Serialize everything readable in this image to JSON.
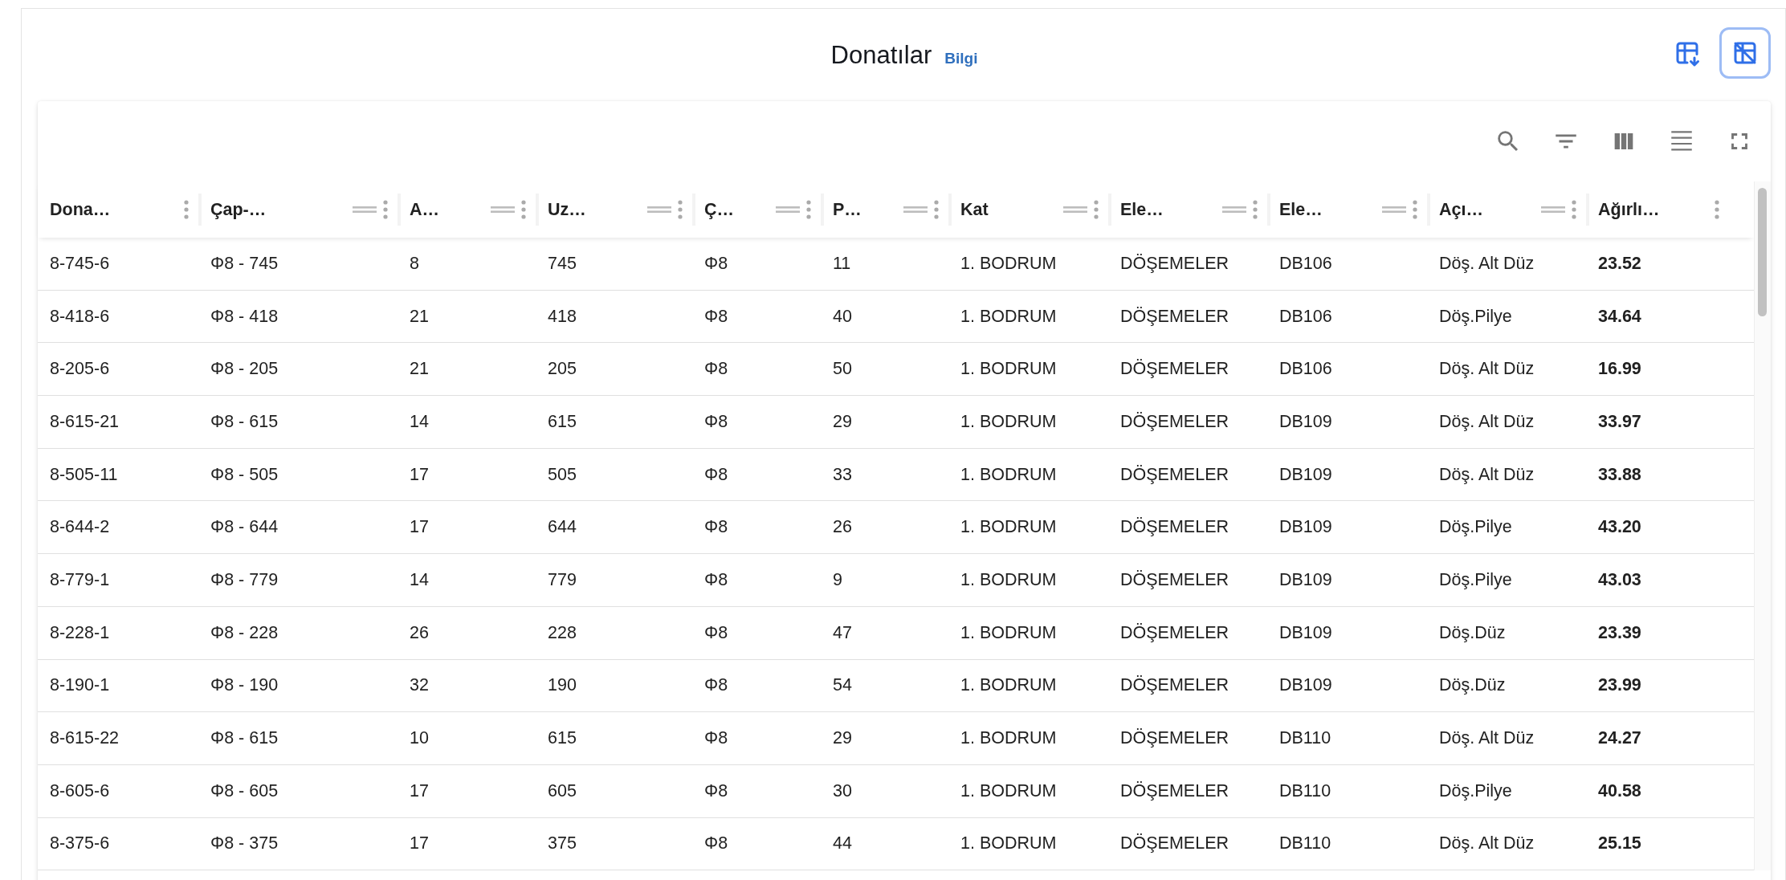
{
  "header": {
    "title": "Donatılar",
    "info_link": "Bilgi",
    "actions": [
      {
        "kind": "export",
        "focused": false
      },
      {
        "kind": "clear",
        "focused": true
      }
    ]
  },
  "toolbar": {
    "tools": [
      {
        "kind": "search"
      },
      {
        "kind": "filter"
      },
      {
        "kind": "columns"
      },
      {
        "kind": "density"
      },
      {
        "kind": "fullscreen"
      }
    ]
  },
  "table": {
    "columns": [
      {
        "label": "Dona…",
        "bold": false
      },
      {
        "label": "Çap-…",
        "drag_handle": true,
        "bold": false
      },
      {
        "label": "A…",
        "drag_handle": true,
        "bold": false
      },
      {
        "label": "Uz…",
        "drag_handle": true,
        "bold": false
      },
      {
        "label": "Ç…",
        "drag_handle": true,
        "bold": false
      },
      {
        "label": "P…",
        "drag_handle": true,
        "bold": false
      },
      {
        "label": "Kat",
        "drag_handle": true,
        "bold": false
      },
      {
        "label": "Ele…",
        "drag_handle": true,
        "bold": false
      },
      {
        "label": "Ele…",
        "drag_handle": true,
        "bold": false
      },
      {
        "label": "Açı…",
        "drag_handle": true,
        "bold": false
      },
      {
        "label": "Ağırlı…",
        "drag_handle": false,
        "bold": true
      }
    ],
    "rows": [
      [
        "8-745-6",
        "Φ8 - 745",
        "8",
        "745",
        "Φ8",
        "11",
        "1. BODRUM",
        "DÖŞEMELER",
        "DB106",
        "Döş. Alt Düz",
        "23.52"
      ],
      [
        "8-418-6",
        "Φ8 - 418",
        "21",
        "418",
        "Φ8",
        "40",
        "1. BODRUM",
        "DÖŞEMELER",
        "DB106",
        "Döş.Pilye",
        "34.64"
      ],
      [
        "8-205-6",
        "Φ8 - 205",
        "21",
        "205",
        "Φ8",
        "50",
        "1. BODRUM",
        "DÖŞEMELER",
        "DB106",
        "Döş. Alt Düz",
        "16.99"
      ],
      [
        "8-615-21",
        "Φ8 - 615",
        "14",
        "615",
        "Φ8",
        "29",
        "1. BODRUM",
        "DÖŞEMELER",
        "DB109",
        "Döş. Alt Düz",
        "33.97"
      ],
      [
        "8-505-11",
        "Φ8 - 505",
        "17",
        "505",
        "Φ8",
        "33",
        "1. BODRUM",
        "DÖŞEMELER",
        "DB109",
        "Döş. Alt Düz",
        "33.88"
      ],
      [
        "8-644-2",
        "Φ8 - 644",
        "17",
        "644",
        "Φ8",
        "26",
        "1. BODRUM",
        "DÖŞEMELER",
        "DB109",
        "Döş.Pilye",
        "43.20"
      ],
      [
        "8-779-1",
        "Φ8 - 779",
        "14",
        "779",
        "Φ8",
        "9",
        "1. BODRUM",
        "DÖŞEMELER",
        "DB109",
        "Döş.Pilye",
        "43.03"
      ],
      [
        "8-228-1",
        "Φ8 - 228",
        "26",
        "228",
        "Φ8",
        "47",
        "1. BODRUM",
        "DÖŞEMELER",
        "DB109",
        "Döş.Düz",
        "23.39"
      ],
      [
        "8-190-1",
        "Φ8 - 190",
        "32",
        "190",
        "Φ8",
        "54",
        "1. BODRUM",
        "DÖŞEMELER",
        "DB109",
        "Döş.Düz",
        "23.99"
      ],
      [
        "8-615-22",
        "Φ8 - 615",
        "10",
        "615",
        "Φ8",
        "29",
        "1. BODRUM",
        "DÖŞEMELER",
        "DB110",
        "Döş. Alt Düz",
        "24.27"
      ],
      [
        "8-605-6",
        "Φ8 - 605",
        "17",
        "605",
        "Φ8",
        "30",
        "1. BODRUM",
        "DÖŞEMELER",
        "DB110",
        "Döş.Pilye",
        "40.58"
      ],
      [
        "8-375-6",
        "Φ8 - 375",
        "17",
        "375",
        "Φ8",
        "44",
        "1. BODRUM",
        "DÖŞEMELER",
        "DB110",
        "Döş. Alt Düz",
        "25.15"
      ]
    ]
  }
}
